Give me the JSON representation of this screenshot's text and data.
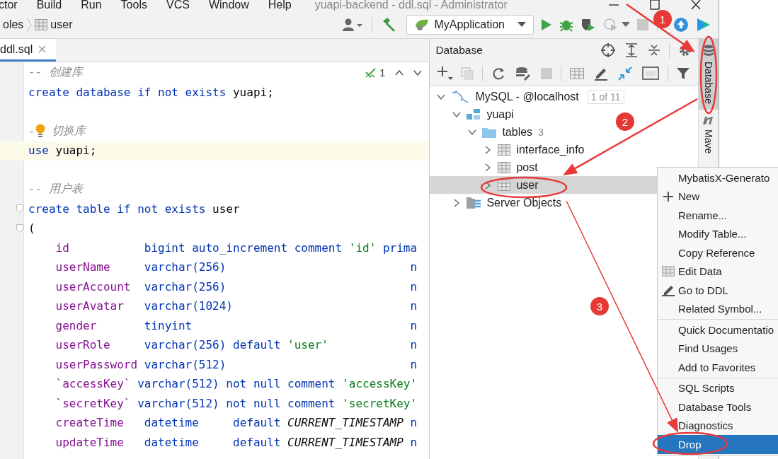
{
  "menu_bar": [
    "ctor",
    "Build",
    "Run",
    "Tools",
    "VCS",
    "Window",
    "Help"
  ],
  "window": {
    "title": "yuapi-backend - ddl.sql - Administrator"
  },
  "breadcrumb": [
    "oles",
    "user"
  ],
  "run_config": "MyApplication",
  "tabs": [
    {
      "label": "ddl.sql",
      "selected": true
    }
  ],
  "editor": {
    "inspection_count": "1",
    "lines": [
      {
        "current": false,
        "tokens": [
          {
            "kind": "comment",
            "t": "-- 创建库"
          }
        ]
      },
      {
        "current": false,
        "tokens": [
          {
            "kind": "keyword",
            "t": "create database if not exists "
          },
          {
            "kind": "name",
            "t": "yuapi;"
          }
        ]
      },
      {
        "current": false
      },
      {
        "current": false,
        "tokens": [
          {
            "kind": "comment",
            "t": "-"
          },
          {
            "kind": "bulb"
          },
          {
            "kind": "comment",
            "t": " 切换库"
          }
        ]
      },
      {
        "current": true,
        "tokens": [
          {
            "kind": "keyword",
            "t": "use "
          },
          {
            "kind": "name",
            "t": "yuapi;"
          }
        ]
      },
      {
        "current": false
      },
      {
        "current": false,
        "tokens": [
          {
            "kind": "comment",
            "t": "-- 用户表"
          }
        ]
      },
      {
        "current": false,
        "fold": true,
        "tokens": [
          {
            "kind": "keyword",
            "t": "create table if not exists "
          },
          {
            "kind": "name",
            "t": "user"
          }
        ]
      },
      {
        "current": false,
        "fold": true,
        "tokens": [
          {
            "kind": "name",
            "t": "("
          }
        ]
      },
      {
        "current": false,
        "tokens": [
          {
            "kind": "column",
            "t": "    id           "
          },
          {
            "kind": "keyword",
            "t": "bigint auto_increment comment "
          },
          {
            "kind": "string",
            "t": "'id'"
          },
          {
            "kind": "keyword",
            "t": " prima"
          }
        ]
      },
      {
        "current": false,
        "tokens": [
          {
            "kind": "column",
            "t": "    userName     "
          },
          {
            "kind": "keyword",
            "t": "varchar(256)                           n"
          }
        ]
      },
      {
        "current": false,
        "tokens": [
          {
            "kind": "column",
            "t": "    userAccount  "
          },
          {
            "kind": "keyword",
            "t": "varchar(256)                           n"
          }
        ]
      },
      {
        "current": false,
        "tokens": [
          {
            "kind": "column",
            "t": "    userAvatar   "
          },
          {
            "kind": "keyword",
            "t": "varchar(1024)                          n"
          }
        ]
      },
      {
        "current": false,
        "tokens": [
          {
            "kind": "column",
            "t": "    gender       "
          },
          {
            "kind": "keyword",
            "t": "tinyint                                n"
          }
        ]
      },
      {
        "current": false,
        "tokens": [
          {
            "kind": "column",
            "t": "    userRole     "
          },
          {
            "kind": "keyword",
            "t": "varchar(256) default "
          },
          {
            "kind": "string",
            "t": "'user'"
          },
          {
            "kind": "keyword",
            "t": "            n"
          }
        ]
      },
      {
        "current": false,
        "tokens": [
          {
            "kind": "column",
            "t": "    userPassword "
          },
          {
            "kind": "keyword",
            "t": "varchar(512)                           n"
          }
        ]
      },
      {
        "current": false,
        "tokens": [
          {
            "kind": "column",
            "t": "    `accessKey` "
          },
          {
            "kind": "keyword",
            "t": "varchar(512) not null comment "
          },
          {
            "kind": "string",
            "t": "'accessKey'"
          }
        ]
      },
      {
        "current": false,
        "tokens": [
          {
            "kind": "column",
            "t": "    `secretKey` "
          },
          {
            "kind": "keyword",
            "t": "varchar(512) not null comment "
          },
          {
            "kind": "string",
            "t": "'secretKey'"
          }
        ]
      },
      {
        "current": false,
        "tokens": [
          {
            "kind": "column",
            "t": "    createTime   "
          },
          {
            "kind": "keyword",
            "t": "datetime     default "
          },
          {
            "kind": "constant",
            "t": "CURRENT_TIMESTAMP"
          },
          {
            "kind": "keyword",
            "t": " n"
          }
        ]
      },
      {
        "current": false,
        "tokens": [
          {
            "kind": "column",
            "t": "    updateTime   "
          },
          {
            "kind": "keyword",
            "t": "datetime     default "
          },
          {
            "kind": "constant",
            "t": "CURRENT_TIMESTAMP"
          },
          {
            "kind": "keyword",
            "t": " n"
          }
        ]
      }
    ]
  },
  "database_panel": {
    "title": "Database",
    "tree": [
      {
        "label": "MySQL - @localhost",
        "kind": "datasource",
        "badge": "1 of 11",
        "expanded": true,
        "selected": false,
        "children": [
          {
            "label": "yuapi",
            "kind": "schema",
            "expanded": true,
            "selected": false,
            "children": [
              {
                "label": "tables",
                "kind": "folder",
                "count": "3",
                "expanded": true,
                "selected": false,
                "children": [
                  {
                    "label": "interface_info",
                    "kind": "table",
                    "expanded": false,
                    "selected": false
                  },
                  {
                    "label": "post",
                    "kind": "table",
                    "expanded": false,
                    "selected": false
                  },
                  {
                    "label": "user",
                    "kind": "table",
                    "expanded": false,
                    "selected": true
                  }
                ]
              }
            ]
          },
          {
            "label": "Server Objects",
            "kind": "server",
            "expanded": false,
            "selected": false
          }
        ]
      }
    ]
  },
  "tool_stripe": [
    {
      "label": "Database",
      "kind": "database",
      "selected": true
    },
    {
      "label": "Mave",
      "kind": "maven",
      "selected": false
    }
  ],
  "context_menu": {
    "groups": [
      [
        {
          "label": "MybatisX-Generato",
          "kind": "text",
          "selected": false
        },
        {
          "label": "New",
          "kind": "plus",
          "selected": false
        },
        {
          "label": "Rename...",
          "kind": "text",
          "selected": false
        },
        {
          "label": "Modify Table...",
          "kind": "text",
          "selected": false
        },
        {
          "label": "Copy Reference",
          "kind": "text",
          "selected": false
        },
        {
          "label": "Edit Data",
          "kind": "table",
          "selected": false
        },
        {
          "label": "Go to DDL",
          "kind": "pencil",
          "selected": false
        },
        {
          "label": "Related Symbol...",
          "kind": "text",
          "selected": false
        }
      ],
      [
        {
          "label": "Quick Documentatio",
          "kind": "text",
          "selected": false
        },
        {
          "label": "Find Usages",
          "kind": "text",
          "selected": false
        },
        {
          "label": "Add to Favorites",
          "kind": "text",
          "selected": false
        }
      ],
      [
        {
          "label": "SQL Scripts",
          "kind": "text",
          "selected": false
        },
        {
          "label": "Database Tools",
          "kind": "text",
          "selected": false
        },
        {
          "label": "Diagnostics",
          "kind": "text",
          "selected": false
        },
        {
          "label": "Drop",
          "kind": "text",
          "selected": true
        }
      ]
    ]
  },
  "annotations": [
    {
      "label": "1"
    },
    {
      "label": "2"
    },
    {
      "label": "3"
    }
  ]
}
